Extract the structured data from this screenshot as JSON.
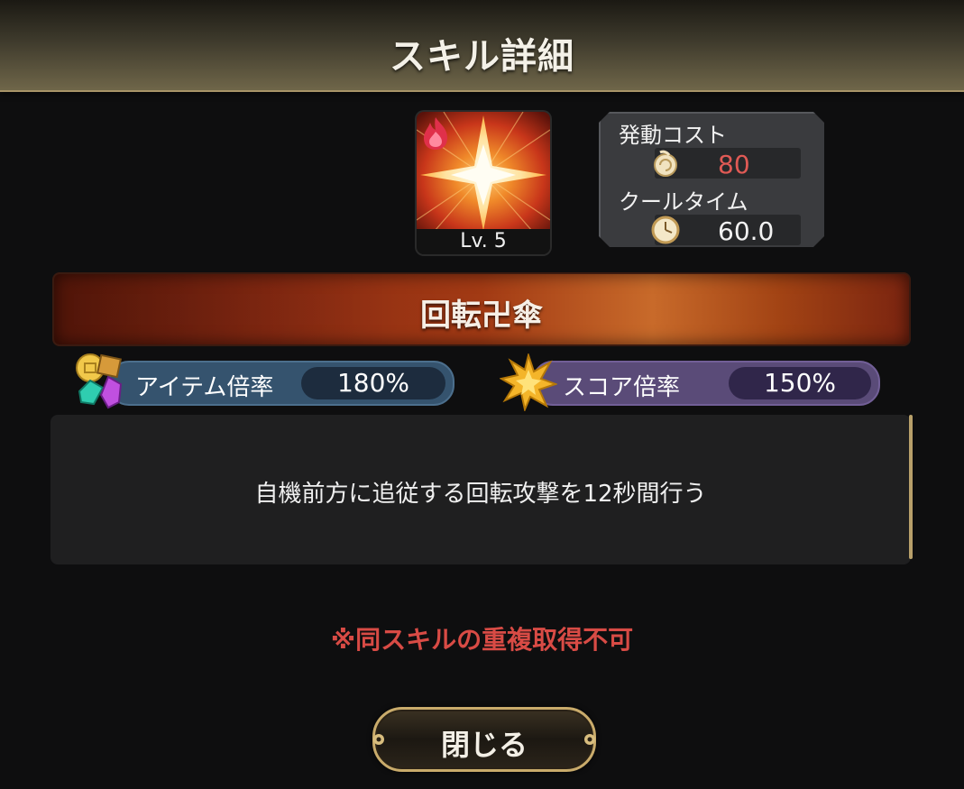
{
  "header": {
    "title": "スキル詳細"
  },
  "skill": {
    "level_label": "Lv. 5",
    "name": "回転卍傘",
    "element_icon": "fire-icon",
    "image_icon": "burst-star-icon"
  },
  "cost_panel": {
    "activation_cost_label": "発動コスト",
    "activation_cost_value": "80",
    "cooldown_label": "クールタイム",
    "cooldown_value": "60.0"
  },
  "multipliers": {
    "item_label": "アイテム倍率",
    "item_value": "180%",
    "score_label": "スコア倍率",
    "score_value": "150%"
  },
  "description": "自機前方に追従する回転攻撃を12秒間行う",
  "notice": "※同スキルの重複取得不可",
  "close_button": "閉じる",
  "colors": {
    "cost_value": "#e05a55",
    "notice": "#d84b45",
    "item_pill": "#35536e",
    "score_pill": "#5a4b78",
    "gold_border": "#c9ab6b"
  }
}
